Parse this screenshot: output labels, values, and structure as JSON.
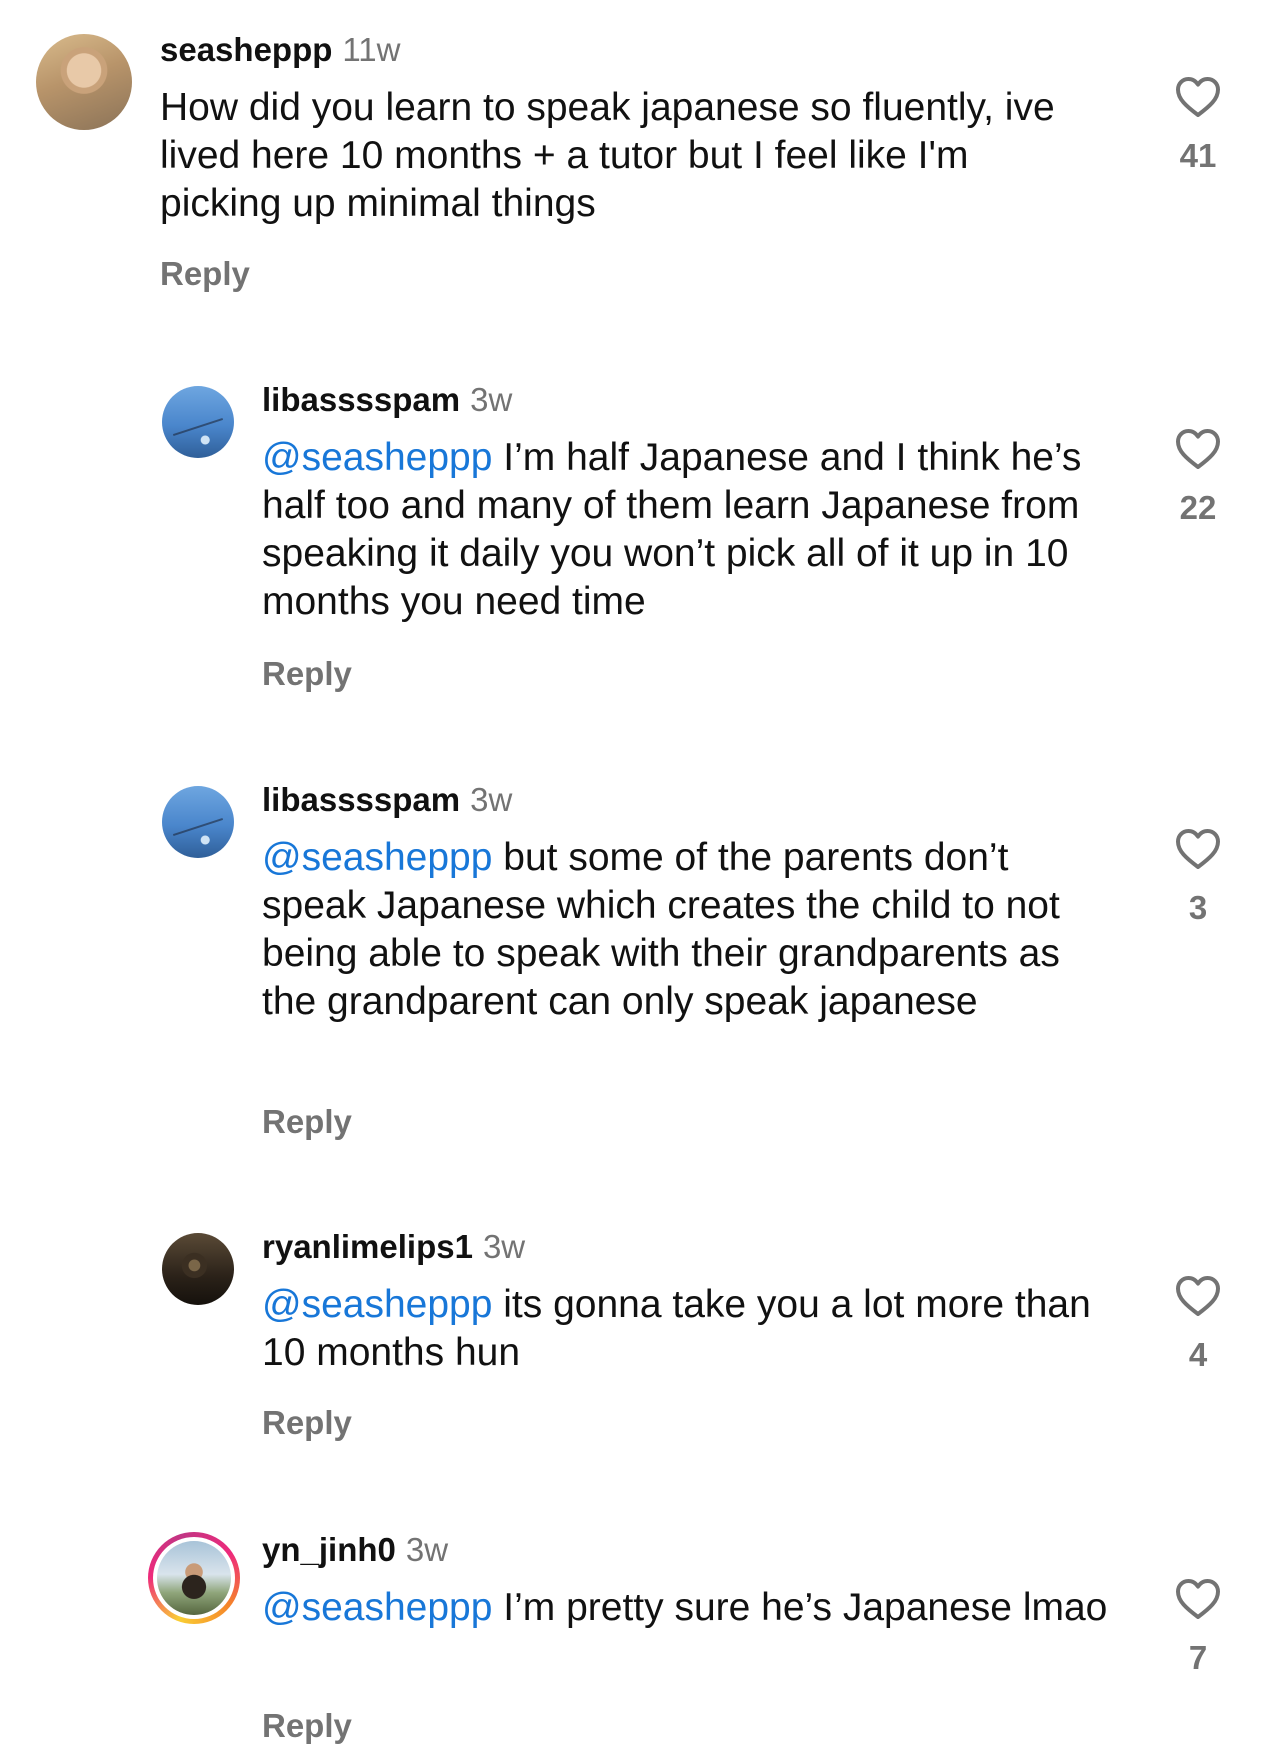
{
  "comments": [
    {
      "username": "seasheppp",
      "time": "11w",
      "mention": "",
      "text": "How did you learn to speak japanese so fluently, ive lived here 10 months + a tutor but I feel like I'm picking up minimal things",
      "reply_label": "Reply",
      "likes": "41",
      "avatar_icon": "profile-photo-icon"
    },
    {
      "username": "libasssspam",
      "time": "3w",
      "mention": "@seasheppp",
      "text": "I’m half Japanese and I think he’s half too and many of them learn Japanese from speaking it daily you won’t pick all of it up in 10 months you need time",
      "reply_label": "Reply",
      "likes": "22",
      "avatar_icon": "sky-photo-icon"
    },
    {
      "username": "libasssspam",
      "time": "3w",
      "mention": "@seasheppp",
      "text": "but some of the parents don’t speak Japanese which creates the child to not being able to speak with their grandparents as the grandparent can only speak japanese",
      "reply_label": "Reply",
      "likes": "3",
      "avatar_icon": "sky-photo-icon"
    },
    {
      "username": "ryanlimelips1",
      "time": "3w",
      "mention": "@seasheppp",
      "text": "its gonna take you a lot more than 10 months hun",
      "reply_label": "Reply",
      "likes": "4",
      "avatar_icon": "dark-photo-icon"
    },
    {
      "username": "yn_jinh0",
      "time": "3w",
      "mention": "@seasheppp",
      "text": "I’m pretty sure he’s Japanese lmao",
      "reply_label": "Reply",
      "likes": "7",
      "avatar_icon": "story-photo-icon"
    }
  ],
  "colors": {
    "mention": "#1877d8",
    "secondary_text": "#737373",
    "primary_text": "#111111",
    "background": "#ffffff"
  }
}
